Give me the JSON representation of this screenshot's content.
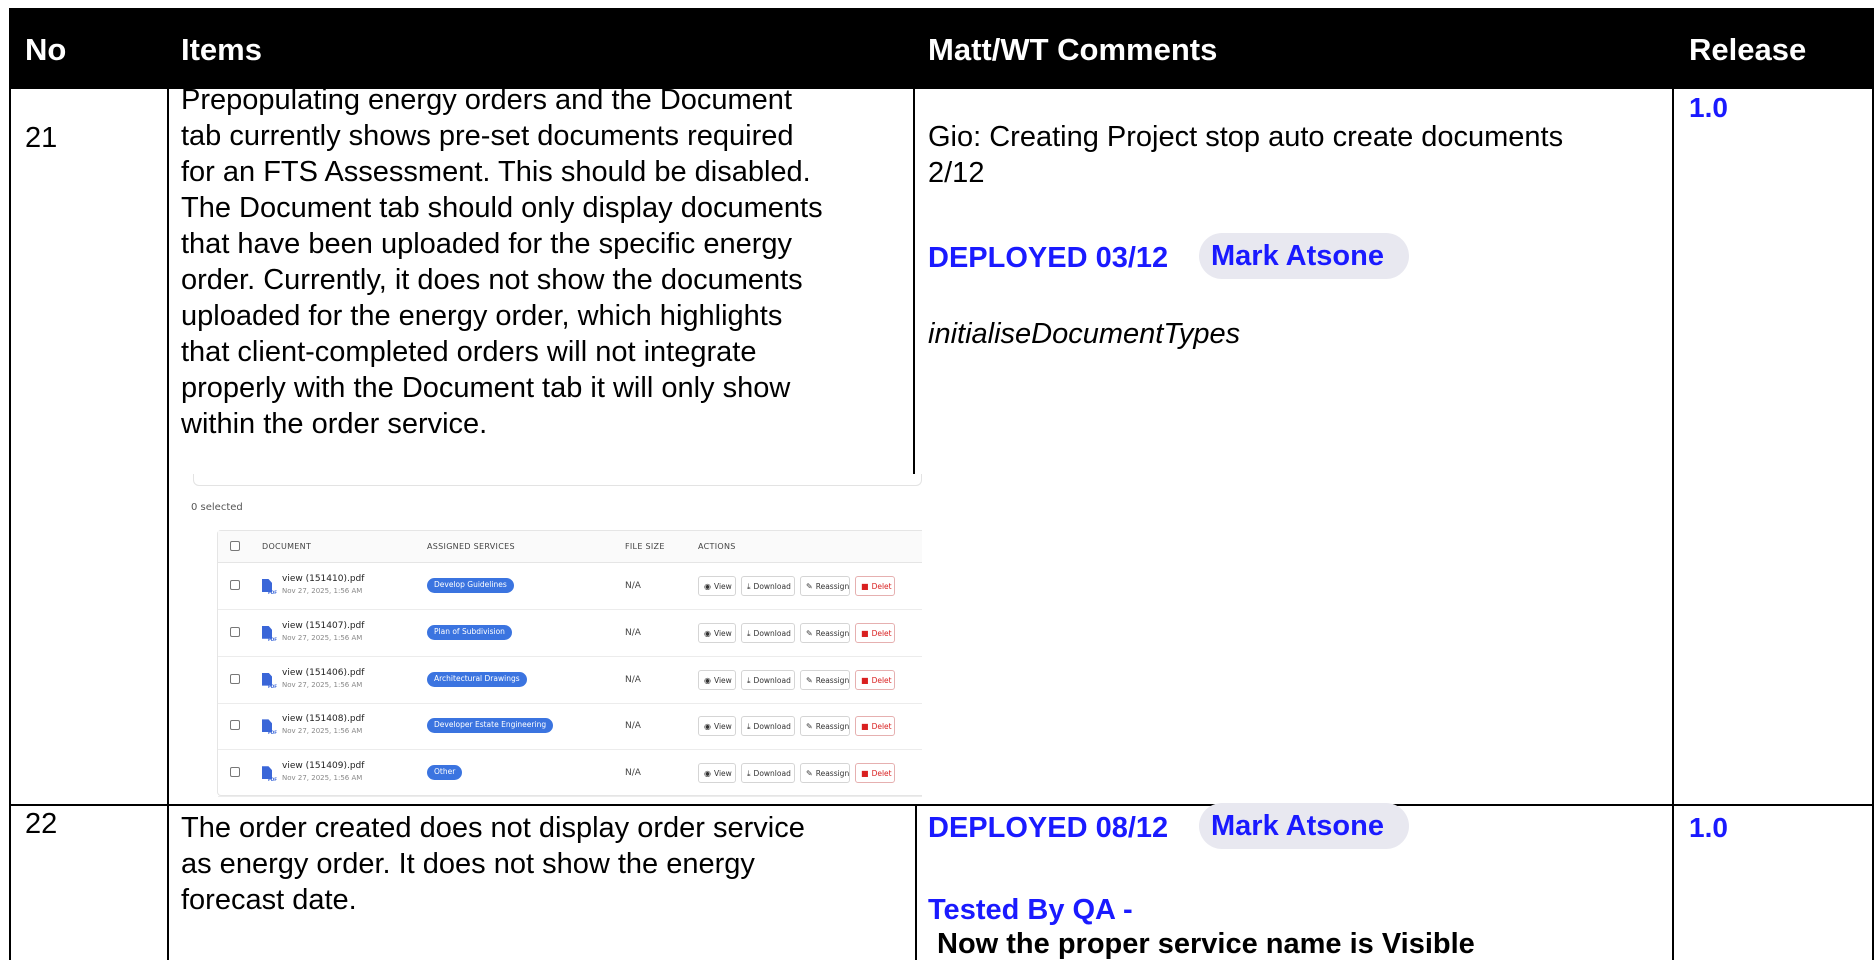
{
  "header": {
    "col_no": "No",
    "col_items": "Items",
    "col_comments": "Matt/WT Comments",
    "col_release": "Release"
  },
  "rows": [
    {
      "no": "21",
      "item_lines": [
        "Prepopulating energy orders and the Document",
        "tab currently shows pre-set documents required",
        "for an FTS Assessment. This should be disabled.",
        "The Document tab should only display documents",
        "that have been uploaded for the specific energy",
        "order. Currently, it does not show the documents",
        "uploaded for the energy order, which highlights",
        "that client-completed orders will not integrate",
        "properly with the Document tab it will only show",
        "within the order service."
      ],
      "comment_line1": "Gio: Creating Project stop auto create documents",
      "comment_line2": "2/12",
      "deployed": "DEPLOYED 03/12",
      "person_chip": "Mark Atsone",
      "function_name": "initialiseDocumentTypes",
      "release": "1.0"
    },
    {
      "no": "22",
      "item_lines": [
        "The order created does not display order service",
        "as energy order. It does not show the energy",
        "forecast date."
      ],
      "deployed": "DEPLOYED 08/12",
      "person_chip": "Mark Atsone",
      "tested_by": "Tested By QA -",
      "tested_note": "Now the proper service name is Visible",
      "release": "1.0"
    }
  ],
  "screenshot": {
    "selected_count": "0 selected",
    "columns": [
      "DOCUMENT",
      "ASSIGNED SERVICES",
      "FILE SIZE",
      "ACTIONS"
    ],
    "actions": {
      "view": "View",
      "download": "Download",
      "reassign": "Reassign",
      "delete": "Delet"
    },
    "files": [
      {
        "name": "view (151410).pdf",
        "date": "Nov 27, 2025, 1:56 AM",
        "service": "Develop Guidelines",
        "size": "N/A"
      },
      {
        "name": "view (151407).pdf",
        "date": "Nov 27, 2025, 1:56 AM",
        "service": "Plan of Subdivision",
        "size": "N/A"
      },
      {
        "name": "view (151406).pdf",
        "date": "Nov 27, 2025, 1:56 AM",
        "service": "Architectural Drawings",
        "size": "N/A"
      },
      {
        "name": "view (151408).pdf",
        "date": "Nov 27, 2025, 1:56 AM",
        "service": "Developer Estate Engineering",
        "size": "N/A"
      },
      {
        "name": "view (151409).pdf",
        "date": "Nov 27, 2025, 1:56 AM",
        "service": "Other",
        "size": "N/A"
      }
    ],
    "pdf_tag": "PDF"
  },
  "colors": {
    "header_bg": "#000000",
    "accent_blue": "#1a1aff",
    "pill_blue": "#3b74e0",
    "delete_red": "#d92020"
  }
}
